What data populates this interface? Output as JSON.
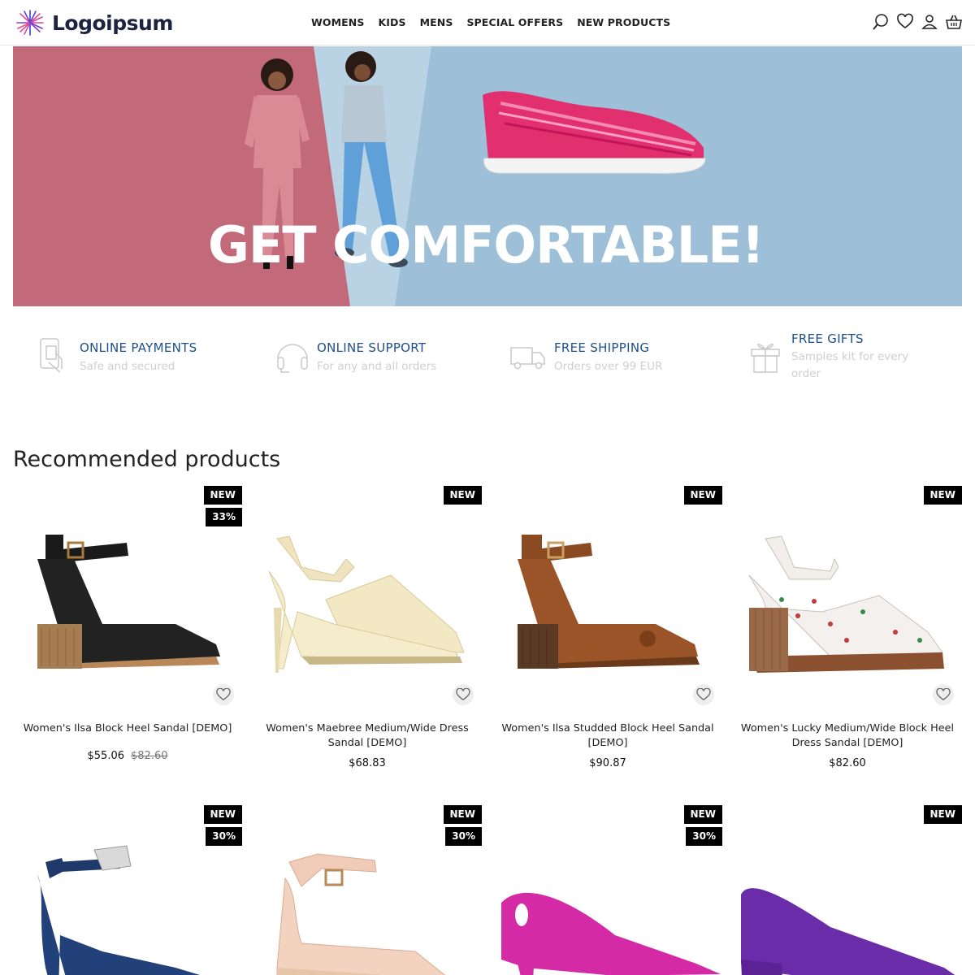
{
  "brand": {
    "name": "Logoipsum"
  },
  "nav": [
    "WOMENS",
    "KIDS",
    "MENS",
    "SPECIAL OFFERS",
    "NEW PRODUCTS"
  ],
  "header_icons": [
    "search-icon",
    "heart-icon",
    "user-icon",
    "basket-icon"
  ],
  "hero": {
    "title": "GET COMFORTABLE!"
  },
  "features": [
    {
      "icon": "payment-card-icon",
      "title": "ONLINE PAYMENTS",
      "subtitle": "Safe and secured"
    },
    {
      "icon": "headphones-icon",
      "title": "ONLINE SUPPORT",
      "subtitle": "For any and all orders"
    },
    {
      "icon": "truck-icon",
      "title": "FREE SHIPPING",
      "subtitle": "Orders over 99 EUR"
    },
    {
      "icon": "gift-icon",
      "title": "FREE GIFTS",
      "subtitle": "Samples kit for every order"
    }
  ],
  "section": {
    "title": "Recommended products"
  },
  "products": [
    {
      "name": "Women's Ilsa Block Heel Sandal [DEMO]",
      "price": "$55.06",
      "old_price": "$82.60",
      "badges": [
        "NEW",
        "33%"
      ],
      "shoe": "black ankle-strap block heel sandal"
    },
    {
      "name": "Women's Maebree Medium/Wide Dress Sandal [DEMO]",
      "price": "$68.83",
      "old_price": "",
      "badges": [
        "NEW"
      ],
      "shoe": "cream strappy stiletto sandal"
    },
    {
      "name": "Women's Ilsa Studded Block Heel Sandal [DEMO]",
      "price": "$90.87",
      "old_price": "",
      "badges": [
        "NEW"
      ],
      "shoe": "brown studded block heel sandal"
    },
    {
      "name": "Women's Lucky Medium/Wide Block Heel Dress Sandal [DEMO]",
      "price": "$82.60",
      "old_price": "",
      "badges": [
        "NEW"
      ],
      "shoe": "floral print block heel sandal"
    },
    {
      "name": "",
      "price": "",
      "old_price": "",
      "badges": [
        "NEW",
        "30%"
      ],
      "shoe": "navy ankle-strap pump"
    },
    {
      "name": "",
      "price": "",
      "old_price": "",
      "badges": [
        "NEW",
        "30%"
      ],
      "shoe": "blush scalloped wedge sandal"
    },
    {
      "name": "",
      "price": "",
      "old_price": "",
      "badges": [
        "NEW",
        "30%"
      ],
      "shoe": "magenta kitten heel pump"
    },
    {
      "name": "",
      "price": "",
      "old_price": "",
      "badges": [
        "NEW"
      ],
      "shoe": "purple block heel pump"
    }
  ],
  "colors": {
    "brand_navy": "#1b2340",
    "feature_blue": "#1e4f8a",
    "hero_pink": "#c26a7a",
    "hero_blue": "#9dbfd8",
    "badge_bg": "#000000"
  }
}
